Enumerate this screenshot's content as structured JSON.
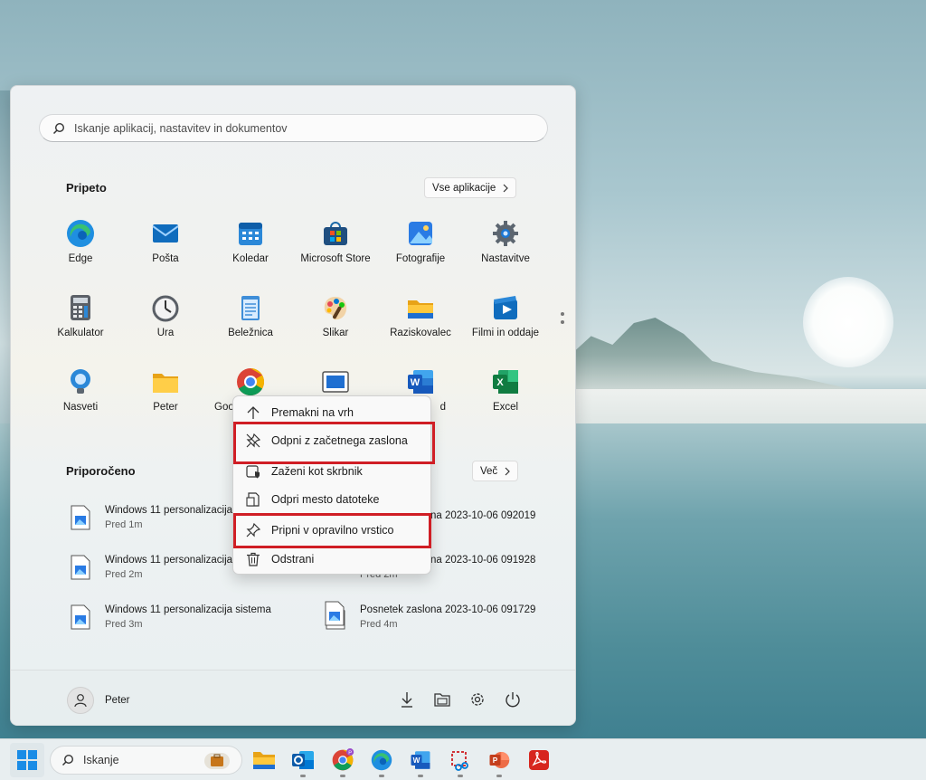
{
  "search": {
    "placeholder": "Iskanje aplikacij, nastavitev in dokumentov"
  },
  "pinned": {
    "title": "Pripeto",
    "all_apps_label": "Vse aplikacije",
    "apps": [
      {
        "label": "Edge",
        "icon": "edge-icon"
      },
      {
        "label": "Pošta",
        "icon": "mail-icon"
      },
      {
        "label": "Koledar",
        "icon": "calendar-icon"
      },
      {
        "label": "Microsoft Store",
        "icon": "store-icon"
      },
      {
        "label": "Fotografije",
        "icon": "photos-icon"
      },
      {
        "label": "Nastavitve",
        "icon": "settings-gear-icon"
      },
      {
        "label": "Kalkulator",
        "icon": "calculator-icon"
      },
      {
        "label": "Ura",
        "icon": "clock-icon"
      },
      {
        "label": "Beležnica",
        "icon": "notepad-icon"
      },
      {
        "label": "Slikar",
        "icon": "paint-icon"
      },
      {
        "label": "Raziskovalec",
        "icon": "folder-icon"
      },
      {
        "label": "Filmi in oddaje",
        "icon": "movies-icon"
      },
      {
        "label": "Nasveti",
        "icon": "tips-icon"
      },
      {
        "label": "Peter",
        "icon": "folder-icon"
      },
      {
        "label": "Goo",
        "icon": "chrome-icon"
      },
      {
        "label": "",
        "icon": "app-window-icon"
      },
      {
        "label": "d",
        "icon": "word-icon"
      },
      {
        "label": "Excel",
        "icon": "excel-icon"
      }
    ]
  },
  "recommended": {
    "title": "Priporočeno",
    "more_label": "Več",
    "items": [
      {
        "title": "Windows 11 personalizacija",
        "sub": "Pred 1m"
      },
      {
        "title": "Posnetek zaslona 2023-10-06 092019",
        "sub": ""
      },
      {
        "title": "Windows 11 personalizacija",
        "sub": "Pred 2m"
      },
      {
        "title": "Posnetek zaslona 2023-10-06 091928",
        "sub": "Pred 2m"
      },
      {
        "title": "Windows 11 personalizacija sistema",
        "sub": "Pred 3m"
      },
      {
        "title": "Posnetek zaslona 2023-10-06 091729",
        "sub": "Pred 4m"
      }
    ]
  },
  "user": {
    "name": "Peter"
  },
  "context_menu": {
    "items": [
      {
        "label": "Premakni na vrh",
        "icon": "arrow-up-icon"
      },
      {
        "label": "Odpni z začetnega zaslona",
        "icon": "unpin-icon",
        "highlighted": true
      },
      {
        "label": "Zaženi kot skrbnik",
        "icon": "shield-admin-icon"
      },
      {
        "label": "Odpri mesto datoteke",
        "icon": "file-location-icon"
      },
      {
        "label": "Pripni v opravilno vrstico",
        "icon": "pin-icon",
        "highlighted": true
      },
      {
        "label": "Odstrani",
        "icon": "trash-icon"
      }
    ]
  },
  "taskbar": {
    "search_placeholder": "Iskanje"
  },
  "colors": {
    "highlight": "#d01e25",
    "accent": "#0067c0"
  }
}
